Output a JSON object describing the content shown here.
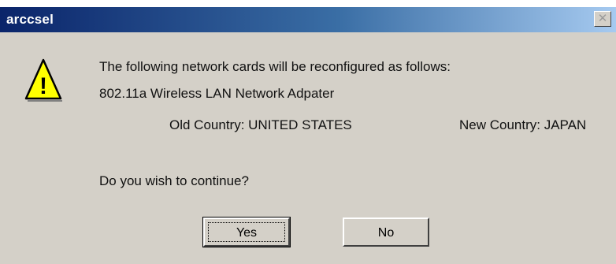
{
  "window": {
    "title": "arccsel",
    "close_glyph": "✕"
  },
  "icon": {
    "name": "warning-icon",
    "glyph": "!"
  },
  "message": {
    "line1": "The following network cards will be reconfigured as follows:",
    "adapter": "802.11a Wireless LAN Network Adpater",
    "old_country": "Old Country: UNITED STATES",
    "new_country": "New Country: JAPAN",
    "question": "Do you wish to continue?"
  },
  "buttons": {
    "yes": "Yes",
    "no": "No"
  },
  "colors": {
    "dialog_bg": "#d4d0c8",
    "titlebar_start": "#0a246a",
    "titlebar_end": "#a6caf0",
    "warning_yellow": "#ffff00"
  }
}
